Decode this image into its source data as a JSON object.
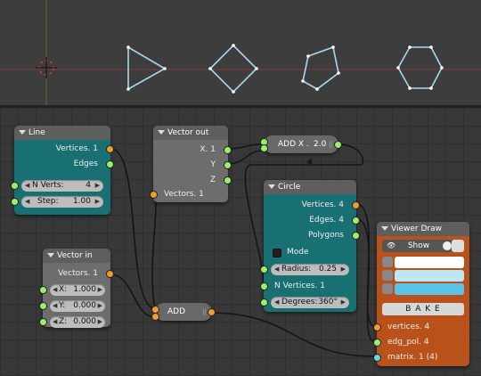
{
  "colors": {
    "node_teal": "#187073",
    "node_grey": "#6d6d6d",
    "node_orange": "#b9521a",
    "socket_vertex": "#f39b2c",
    "socket_data": "#9cf067",
    "socket_matrix": "#6ed3e4",
    "wire": "#151515",
    "polygon_stroke": "#a9d9f2"
  },
  "viewport": {
    "shapes": [
      "triangle",
      "square",
      "pentagon",
      "hexagon"
    ],
    "cursor_icon": "3d-cursor-icon"
  },
  "nodes": {
    "line": {
      "title": "Line",
      "out_vertices": "Vertices. 1",
      "out_edges": "Edges",
      "n_verts_label": "N Verts:",
      "n_verts_value": "4",
      "step_label": "Step:",
      "step_value": "1.00"
    },
    "vector_out": {
      "title": "Vector out",
      "x": "X. 1",
      "y": "Y",
      "z": "Z",
      "in_vectors": "Vectors. 1"
    },
    "add_x": {
      "label": "ADD X .",
      "value": "2.0"
    },
    "circle": {
      "title": "Circle",
      "out_vertices": "Vertices. 4",
      "out_edges": "Edges. 4",
      "out_polygons": "Polygons",
      "mode_label": "Mode",
      "radius_label": "Radius:",
      "radius_value": "0.25",
      "n_vertices": "N Vertices. 1",
      "degrees_label": "Degrees:",
      "degrees_value": "360°"
    },
    "vector_in": {
      "title": "Vector in",
      "out_vectors": "Vectors. 1",
      "x_label": "X:",
      "x_value": "1.000",
      "y_label": "Y:",
      "y_value": "0.000",
      "z_label": "Z:",
      "z_value": "0.000"
    },
    "add": {
      "label": "ADD"
    },
    "viewer_draw": {
      "title": "Viewer Draw",
      "show_label": "Show",
      "bake_label": "B A K E",
      "in_vertices": "vertices. 4",
      "in_edg_pol": "edg_pol. 4",
      "in_matrix": "matrix. 1 (4)",
      "color_vertices": "#ffffff",
      "color_edges": "#bfe6f7",
      "color_faces": "#5bc3ea"
    }
  }
}
